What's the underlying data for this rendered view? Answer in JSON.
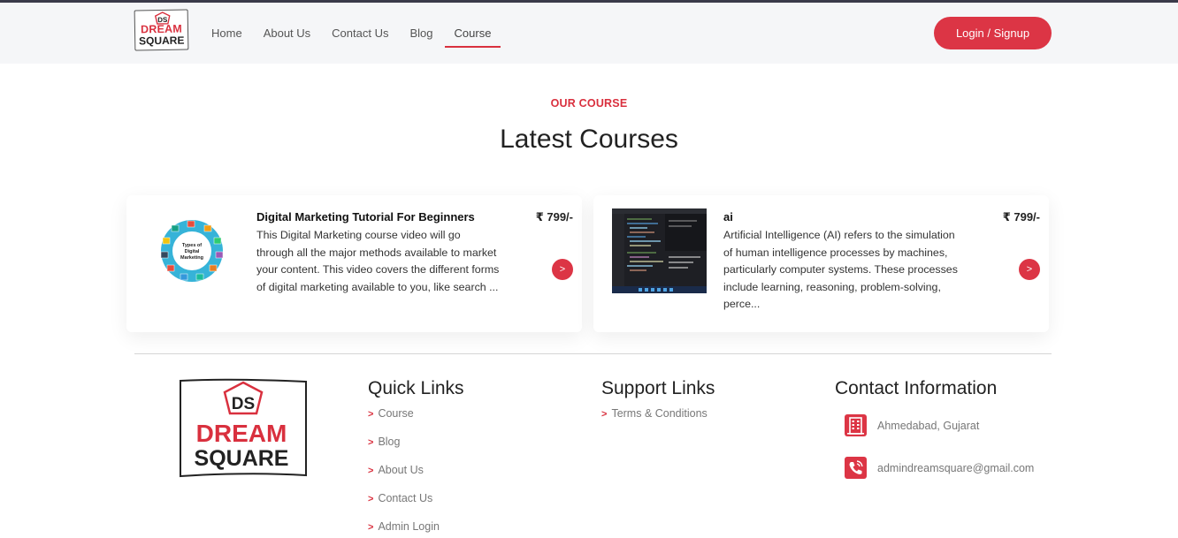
{
  "brand": {
    "line1": "DREAM",
    "line2": "SQUARE",
    "monogram": "DS"
  },
  "nav": {
    "items": [
      {
        "label": "Home"
      },
      {
        "label": "About Us"
      },
      {
        "label": "Contact Us"
      },
      {
        "label": "Blog"
      },
      {
        "label": "Course",
        "active": true
      }
    ],
    "login_label": "Login / Signup"
  },
  "section": {
    "eyebrow": "OUR COURSE",
    "heading": "Latest Courses"
  },
  "courses": [
    {
      "title": "Digital Marketing Tutorial For Beginners",
      "description": "This Digital Marketing course video will go through all the major methods available to market your content. This video covers the different forms of digital marketing available to you, like search ...",
      "price": "₹ 799/-",
      "arrow": ">"
    },
    {
      "title": "ai",
      "description": "Artificial Intelligence (AI) refers to the simulation of human intelligence processes by machines, particularly computer systems. These processes include learning, reasoning, problem-solving, perce...",
      "price": "₹ 799/-",
      "arrow": ">"
    }
  ],
  "footer": {
    "quick_links": {
      "title": "Quick Links",
      "items": [
        "Course",
        "Blog",
        "About Us",
        "Contact Us",
        "Admin Login"
      ]
    },
    "support_links": {
      "title": "Support Links",
      "items": [
        "Terms & Conditions"
      ]
    },
    "contact": {
      "title": "Contact Information",
      "address": "Ahmedabad, Gujarat",
      "email": "admindreamsquare@gmail.com",
      "address_icon": "building-icon",
      "email_icon": "phone-icon"
    },
    "chevron": ">"
  },
  "colors": {
    "accent": "#dc3545",
    "nav_bg": "#f5f6f8",
    "text": "#222222"
  }
}
